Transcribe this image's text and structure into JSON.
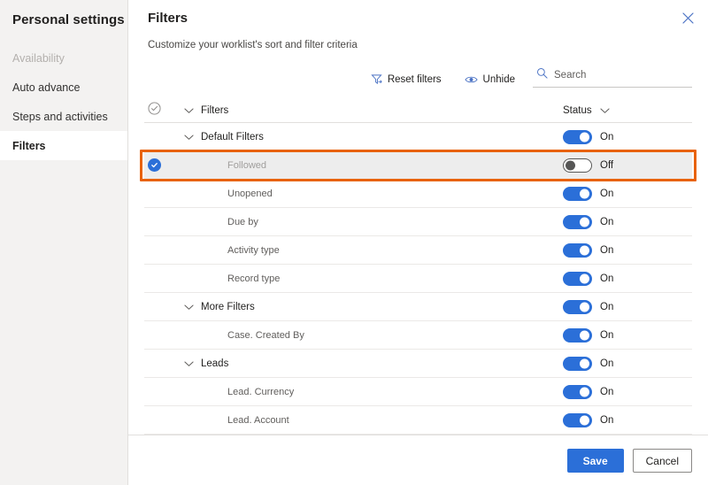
{
  "sidebar": {
    "title": "Personal settings",
    "items": [
      {
        "label": "Availability",
        "state": "disabled"
      },
      {
        "label": "Auto advance",
        "state": "normal"
      },
      {
        "label": "Steps and activities",
        "state": "normal"
      },
      {
        "label": "Filters",
        "state": "selected"
      }
    ]
  },
  "panel": {
    "title": "Filters",
    "subtitle": "Customize your worklist's sort and filter criteria",
    "close_icon": "close-icon"
  },
  "commandbar": {
    "reset_filters": {
      "label": "Reset filters",
      "icon": "filter-reset-icon"
    },
    "unhide": {
      "label": "Unhide",
      "icon": "eye-icon"
    },
    "search": {
      "placeholder": "Search",
      "value": "",
      "icon": "search-icon"
    }
  },
  "table": {
    "header": {
      "select_icon": "circle-check-outline-icon",
      "chevron_icon": "chevron-down-icon",
      "col_filters": "Filters",
      "col_status": "Status",
      "status_chevron_icon": "chevron-down-icon"
    },
    "rows": [
      {
        "label": "Default Filters",
        "type": "group",
        "indent": 1,
        "chevron": true,
        "status": "On",
        "toggle": "on",
        "selected": false,
        "highlighted": false,
        "dim": false
      },
      {
        "label": "Followed",
        "type": "item",
        "indent": 2,
        "chevron": false,
        "status": "Off",
        "toggle": "off",
        "selected": true,
        "highlighted": true,
        "dim": true
      },
      {
        "label": "Unopened",
        "type": "item",
        "indent": 2,
        "chevron": false,
        "status": "On",
        "toggle": "on",
        "selected": false,
        "highlighted": false,
        "dim": false
      },
      {
        "label": "Due by",
        "type": "item",
        "indent": 2,
        "chevron": false,
        "status": "On",
        "toggle": "on",
        "selected": false,
        "highlighted": false,
        "dim": false
      },
      {
        "label": "Activity type",
        "type": "item",
        "indent": 2,
        "chevron": false,
        "status": "On",
        "toggle": "on",
        "selected": false,
        "highlighted": false,
        "dim": false
      },
      {
        "label": "Record type",
        "type": "item",
        "indent": 2,
        "chevron": false,
        "status": "On",
        "toggle": "on",
        "selected": false,
        "highlighted": false,
        "dim": false
      },
      {
        "label": "More Filters",
        "type": "group",
        "indent": 1,
        "chevron": true,
        "status": "On",
        "toggle": "on",
        "selected": false,
        "highlighted": false,
        "dim": false
      },
      {
        "label": "Case. Created By",
        "type": "item",
        "indent": 2,
        "chevron": false,
        "status": "On",
        "toggle": "on",
        "selected": false,
        "highlighted": false,
        "dim": false
      },
      {
        "label": "Leads",
        "type": "group",
        "indent": 1,
        "chevron": true,
        "status": "On",
        "toggle": "on",
        "selected": false,
        "highlighted": false,
        "dim": false
      },
      {
        "label": "Lead. Currency",
        "type": "item",
        "indent": 2,
        "chevron": false,
        "status": "On",
        "toggle": "on",
        "selected": false,
        "highlighted": false,
        "dim": false
      },
      {
        "label": "Lead. Account",
        "type": "item",
        "indent": 2,
        "chevron": false,
        "status": "On",
        "toggle": "on",
        "selected": false,
        "highlighted": false,
        "dim": false
      }
    ]
  },
  "footer": {
    "save_label": "Save",
    "cancel_label": "Cancel"
  },
  "colors": {
    "accent_blue": "#2b6fd8",
    "highlight_orange": "#e8620b",
    "sidebar_bg": "#f3f2f1",
    "row_selected_bg": "#ededed"
  }
}
